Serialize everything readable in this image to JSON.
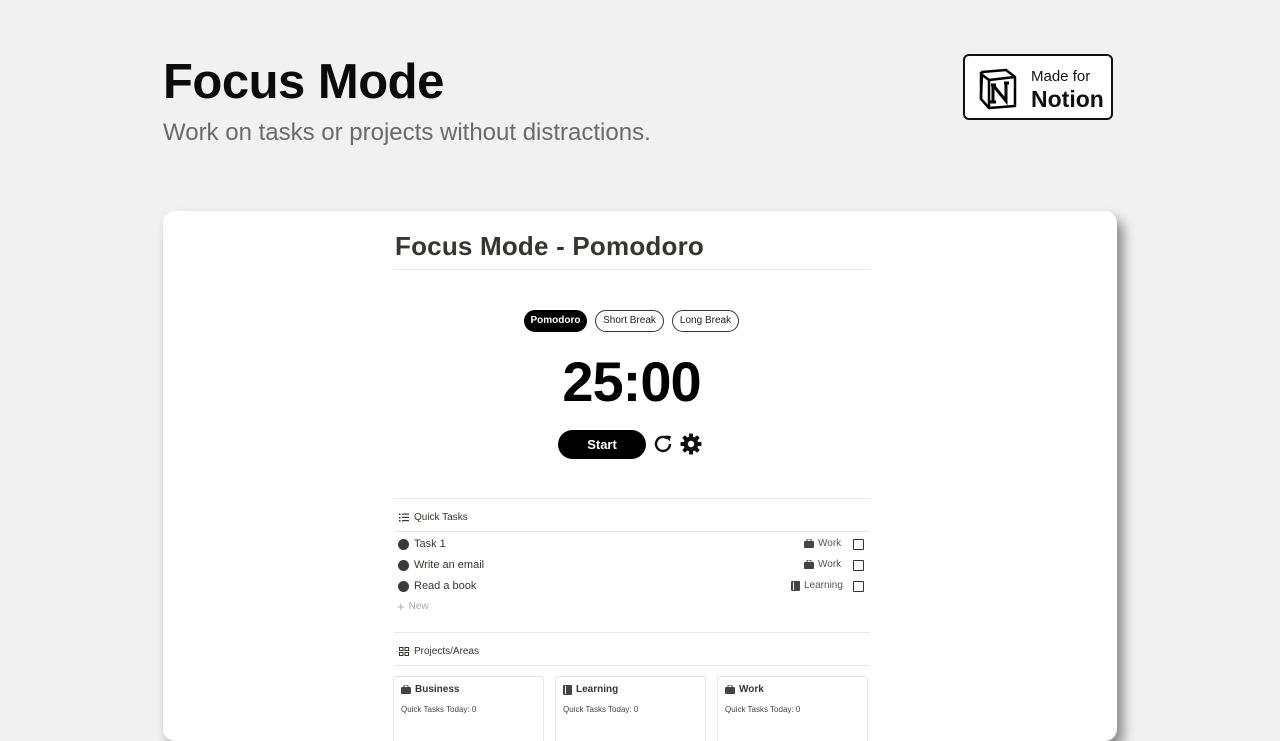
{
  "hero": {
    "title": "Focus Mode",
    "subtitle": "Work on tasks or projects without distractions."
  },
  "badge": {
    "small": "Made for",
    "big": "Notion",
    "icon": "notion-logo"
  },
  "page": {
    "title": "Focus Mode - Pomodoro"
  },
  "timer": {
    "tabs": [
      {
        "label": "Pomodoro",
        "active": true
      },
      {
        "label": "Short Break",
        "active": false
      },
      {
        "label": "Long Break",
        "active": false
      }
    ],
    "display": "25:00",
    "start_label": "Start",
    "reset_icon": "reset-icon",
    "settings_icon": "gear-icon"
  },
  "quick_tasks": {
    "heading": "Quick Tasks",
    "heading_icon": "list-icon",
    "items": [
      {
        "name": "Task 1",
        "tag": "Work",
        "tag_icon": "briefcase-icon"
      },
      {
        "name": "Write an email",
        "tag": "Work",
        "tag_icon": "briefcase-icon"
      },
      {
        "name": "Read a book",
        "tag": "Learning",
        "tag_icon": "book-icon"
      }
    ],
    "new_label": "New"
  },
  "projects": {
    "heading": "Projects/Areas",
    "heading_icon": "grid-icon",
    "cards": [
      {
        "title": "Business",
        "icon": "briefcase-icon",
        "sub": "Quick Tasks Today: 0"
      },
      {
        "title": "Learning",
        "icon": "book-icon",
        "sub": "Quick Tasks Today: 0"
      },
      {
        "title": "Work",
        "icon": "briefcase-icon",
        "sub": "Quick Tasks Today: 0"
      }
    ]
  },
  "colors": {
    "background": "#f1f1f1",
    "text_dark": "#37352f",
    "accent": "#000000"
  }
}
